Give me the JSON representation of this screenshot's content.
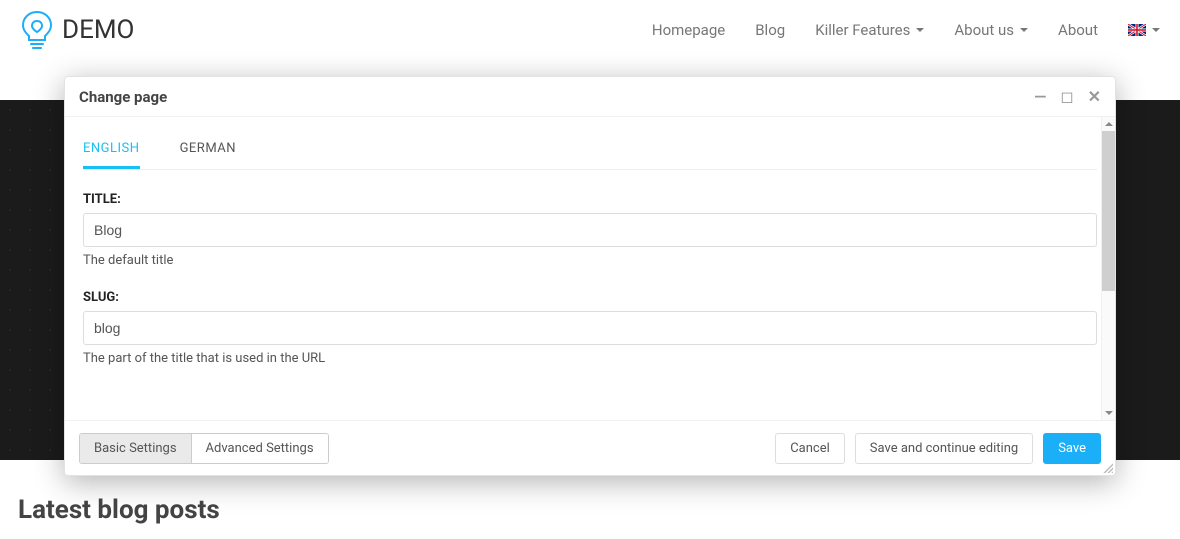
{
  "brand": {
    "text": "DEMO"
  },
  "nav": {
    "items": [
      {
        "label": "Homepage",
        "dropdown": false
      },
      {
        "label": "Blog",
        "dropdown": false
      },
      {
        "label": "Killer Features",
        "dropdown": true
      },
      {
        "label": "About us",
        "dropdown": true
      },
      {
        "label": "About",
        "dropdown": false
      }
    ],
    "language": "en-gb"
  },
  "page": {
    "latest_heading": "Latest blog posts"
  },
  "modal": {
    "title": "Change page",
    "tabs": [
      {
        "label": "ENGLISH",
        "active": true
      },
      {
        "label": "GERMAN",
        "active": false
      }
    ],
    "fields": {
      "title": {
        "label": "TITLE:",
        "value": "Blog",
        "help": "The default title"
      },
      "slug": {
        "label": "SLUG:",
        "value": "blog",
        "help": "The part of the title that is used in the URL"
      }
    },
    "footer": {
      "segmented": [
        {
          "label": "Basic Settings",
          "active": true
        },
        {
          "label": "Advanced Settings",
          "active": false
        }
      ],
      "buttons": {
        "cancel": "Cancel",
        "save_continue": "Save and continue editing",
        "save": "Save"
      }
    }
  }
}
